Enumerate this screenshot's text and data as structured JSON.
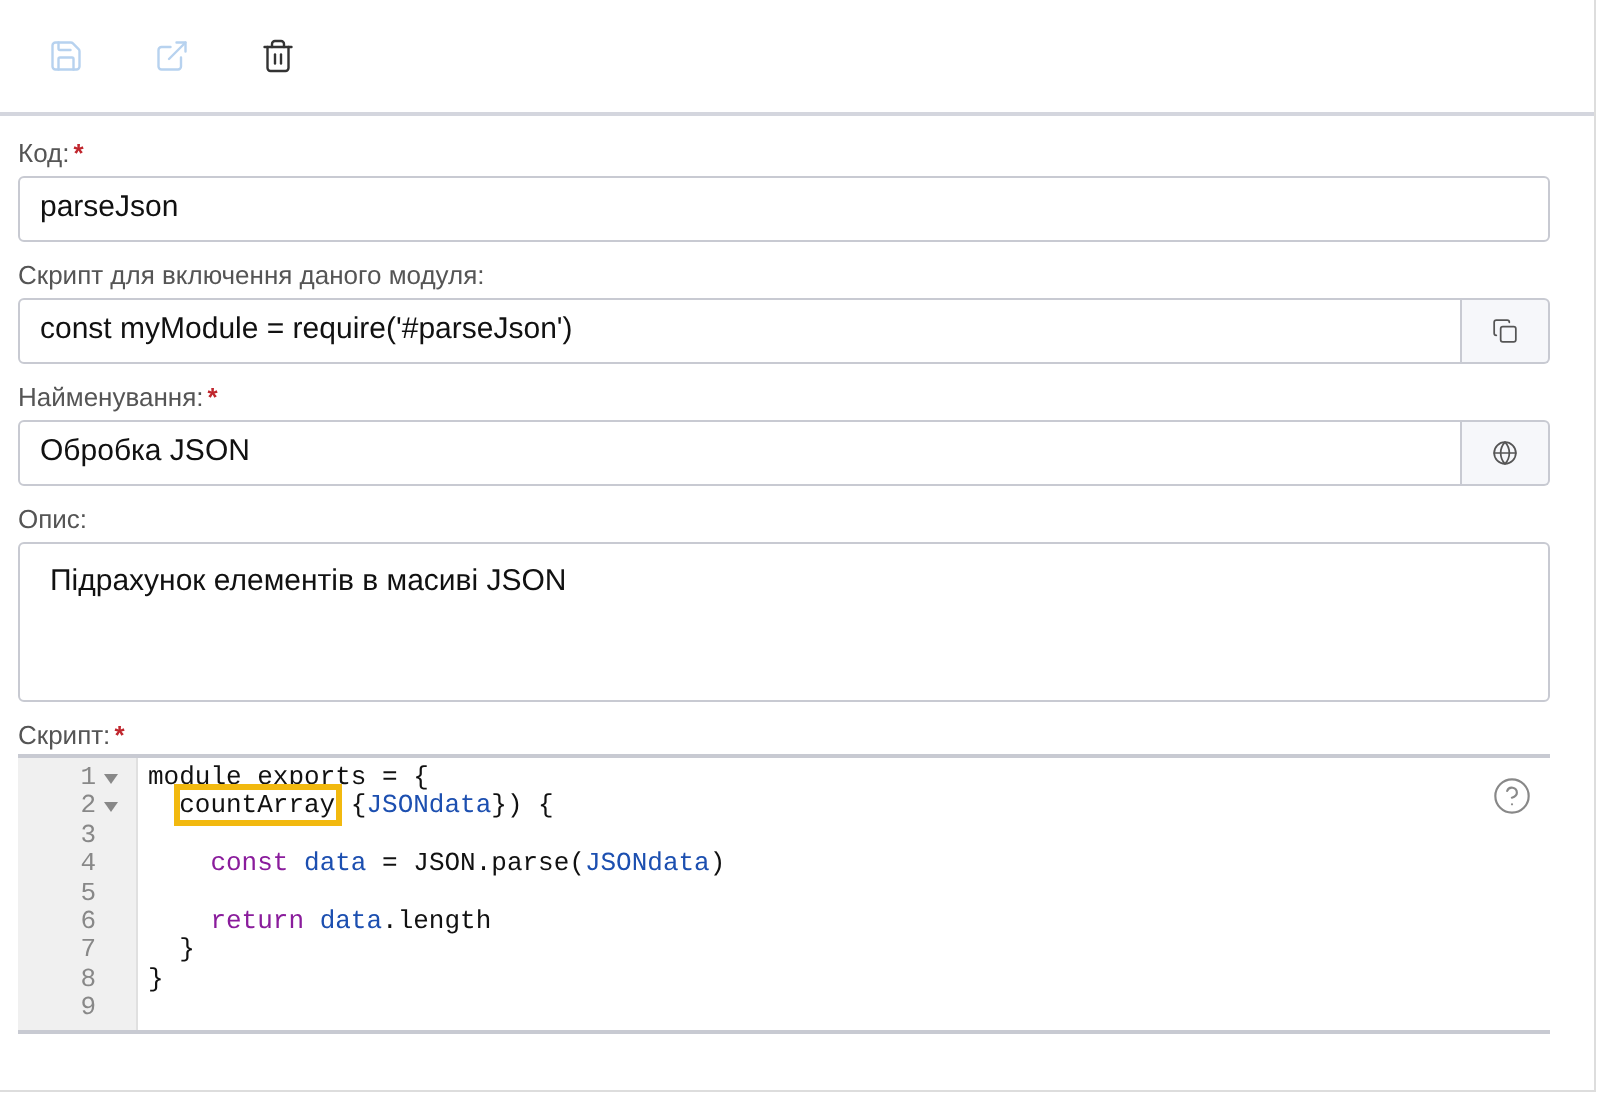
{
  "toolbar": [
    {
      "kind": "save",
      "disabled": true
    },
    {
      "kind": "open",
      "disabled": true
    },
    {
      "kind": "delete",
      "disabled": false
    }
  ],
  "fields": [
    {
      "label": "Код:",
      "required_mark": "*",
      "kind": "input",
      "value": "parseJson"
    },
    {
      "label": "Скрипт для включення даного модуля:",
      "kind": "input_copy",
      "value": "const myModule = require('#parseJson')"
    },
    {
      "label": "Найменування:",
      "required_mark": "*",
      "kind": "input_globe",
      "value": "Обробка JSON"
    },
    {
      "label": "Опис:",
      "kind": "textarea",
      "value": "Підрахунок елементів в масиві JSON"
    }
  ],
  "editor": {
    "label": "Скрипт:",
    "required_mark": "*",
    "lines": [
      {
        "number": "1",
        "foldable": true,
        "tokens": [
          {
            "kind": "plain",
            "text": "module exports = {"
          }
        ],
        "children": [
          {
            "number": "2",
            "foldable": true,
            "tokens": [
              {
                "kind": "highlight",
                "text": "countArray"
              },
              {
                "kind": "plain",
                "text": " {"
              },
              {
                "kind": "variable",
                "text": "JSONdata"
              },
              {
                "kind": "plain",
                "text": "}) {"
              }
            ],
            "children": [
              {
                "number": "3",
                "foldable": false
              },
              {
                "number": "4",
                "foldable": false,
                "tokens": [
                  {
                    "kind": "keyword",
                    "text": "const "
                  },
                  {
                    "kind": "variable",
                    "text": "data"
                  },
                  {
                    "kind": "plain",
                    "text": " = JSON.parse("
                  },
                  {
                    "kind": "variable",
                    "text": "JSONdata"
                  },
                  {
                    "kind": "plain",
                    "text": ")"
                  }
                ]
              },
              {
                "number": "5",
                "foldable": false
              },
              {
                "number": "6",
                "foldable": false,
                "tokens": [
                  {
                    "kind": "keyword",
                    "text": "return "
                  },
                  {
                    "kind": "variable",
                    "text": "data"
                  },
                  {
                    "kind": "plain",
                    "text": ".length"
                  }
                ]
              }
            ]
          },
          {
            "number": "7",
            "foldable": false,
            "tokens": [
              {
                "kind": "plain",
                "text": "}"
              }
            ]
          }
        ]
      },
      {
        "number": "8",
        "foldable": false,
        "tokens": [
          {
            "kind": "plain",
            "text": "}"
          }
        ]
      },
      {
        "number": "9",
        "foldable": false
      }
    ]
  }
}
